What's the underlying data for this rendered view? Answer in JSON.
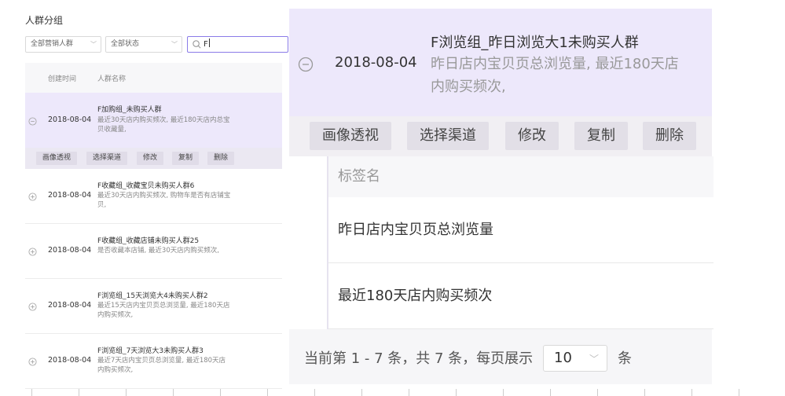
{
  "left": {
    "title": "人群分组",
    "filters": {
      "marketing": "全部营销人群",
      "status": "全部状态",
      "search_value": "F"
    },
    "columns": {
      "created": "创建时间",
      "name": "人群名称"
    },
    "rows": [
      {
        "date": "2018-08-04",
        "name": "F加购组_未购买人群",
        "desc": "最近30天店内购买频次, 最近180天店内总宝贝收藏量,"
      },
      {
        "date": "2018-08-04",
        "name": "F收藏组_收藏宝贝未购买人群6",
        "desc": "最近30天店内购买频次, 购物车是否有店铺宝贝,"
      },
      {
        "date": "2018-08-04",
        "name": "F收藏组_收藏店铺未购买人群25",
        "desc": "是否收藏本店铺, 最近30天店内购买频次,"
      },
      {
        "date": "2018-08-04",
        "name": "F浏览组_15天浏览大4未购买人群2",
        "desc": "最近15天店内宝贝页总浏览量, 最近180天店内购买频次,"
      },
      {
        "date": "2018-08-04",
        "name": "F浏览组_7天浏览大3未购买人群3",
        "desc": "最近7天店内宝贝页总浏览量, 最近180天店内购买频次,"
      }
    ],
    "actions": [
      "画像透视",
      "选择渠道",
      "修改",
      "复制",
      "删除"
    ]
  },
  "right": {
    "date": "2018-08-04",
    "name": "F浏览组_昨日浏览大1未购买人群",
    "desc": "昨日店内宝贝页总浏览量, 最近180天店内购买频次,",
    "actions": [
      "画像透视",
      "选择渠道",
      "修改",
      "复制",
      "删除"
    ],
    "tag_header": "标签名",
    "tags": [
      "昨日店内宝贝页总浏览量",
      "最近180天店内购买频次"
    ],
    "pager": {
      "summary": "当前第 1 - 7 条，共 7 条，每页展示",
      "page_size": "10",
      "unit": "条"
    }
  },
  "colors": {
    "accent": "#8a7be8",
    "active_row": "#ede8fb"
  }
}
